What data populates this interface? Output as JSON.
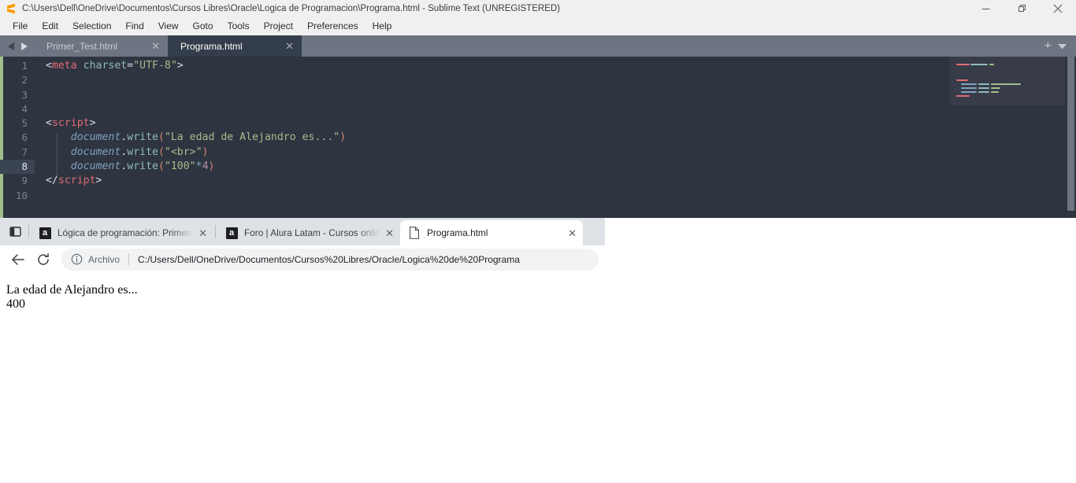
{
  "sublime": {
    "titlebar": {
      "logo_icon": "sublime-text-logo",
      "title": "C:\\Users\\Dell\\OneDrive\\Documentos\\Cursos Libres\\Oracle\\Logica de Programacion\\Programa.html - Sublime Text (UNREGISTERED)",
      "minimize_icon": "minimize-icon",
      "restore_icon": "restore-icon",
      "close_icon": "close-icon"
    },
    "menu": [
      "File",
      "Edit",
      "Selection",
      "Find",
      "View",
      "Goto",
      "Tools",
      "Project",
      "Preferences",
      "Help"
    ],
    "tabs": [
      {
        "label": "Primer_Test.html",
        "active": false,
        "close_icon": "close-icon"
      },
      {
        "label": "Programa.html",
        "active": true,
        "close_icon": "close-icon"
      }
    ],
    "tabstrip": {
      "prev_icon": "triangle-left-icon",
      "next_icon": "triangle-right-icon",
      "add_icon": "plus-icon",
      "dropdown_icon": "chevron-down-icon",
      "add_label": "+"
    },
    "editor": {
      "active_line": 8,
      "line_numbers": [
        "1",
        "2",
        "3",
        "4",
        "5",
        "6",
        "7",
        "8",
        "9",
        "10"
      ],
      "lines": [
        {
          "n": "1",
          "tokens": [
            {
              "t": "<",
              "c": "t-punct"
            },
            {
              "t": "meta",
              "c": "t-tag"
            },
            {
              "t": " ",
              "c": "t-punct"
            },
            {
              "t": "charset",
              "c": "t-attr"
            },
            {
              "t": "=",
              "c": "t-punct"
            },
            {
              "t": "\"UTF-8\"",
              "c": "t-str"
            },
            {
              "t": ">",
              "c": "t-punct"
            }
          ]
        },
        {
          "n": "2",
          "tokens": []
        },
        {
          "n": "3",
          "tokens": []
        },
        {
          "n": "4",
          "tokens": []
        },
        {
          "n": "5",
          "tokens": [
            {
              "t": "<",
              "c": "t-punct"
            },
            {
              "t": "script",
              "c": "t-tag"
            },
            {
              "t": ">",
              "c": "t-punct"
            }
          ]
        },
        {
          "n": "6",
          "tokens": [
            {
              "t": "    ",
              "c": "t-punct"
            },
            {
              "t": "document",
              "c": "t-var"
            },
            {
              "t": ".",
              "c": "t-dot"
            },
            {
              "t": "write",
              "c": "t-prop"
            },
            {
              "t": "(",
              "c": "t-paren"
            },
            {
              "t": "\"La edad de Alejandro es...\"",
              "c": "t-str"
            },
            {
              "t": ")",
              "c": "t-paren"
            }
          ]
        },
        {
          "n": "7",
          "tokens": [
            {
              "t": "    ",
              "c": "t-punct"
            },
            {
              "t": "document",
              "c": "t-var"
            },
            {
              "t": ".",
              "c": "t-dot"
            },
            {
              "t": "write",
              "c": "t-prop"
            },
            {
              "t": "(",
              "c": "t-paren"
            },
            {
              "t": "\"<br>\"",
              "c": "t-str"
            },
            {
              "t": ")",
              "c": "t-paren"
            }
          ]
        },
        {
          "n": "8",
          "tokens": [
            {
              "t": "    ",
              "c": "t-punct"
            },
            {
              "t": "document",
              "c": "t-var"
            },
            {
              "t": ".",
              "c": "t-dot"
            },
            {
              "t": "write",
              "c": "t-prop"
            },
            {
              "t": "(",
              "c": "t-paren"
            },
            {
              "t": "\"100\"",
              "c": "t-str"
            },
            {
              "t": "*",
              "c": "t-op"
            },
            {
              "t": "4",
              "c": "t-num"
            },
            {
              "t": ")",
              "c": "t-paren"
            }
          ]
        },
        {
          "n": "9",
          "tokens": [
            {
              "t": "</",
              "c": "t-punct"
            },
            {
              "t": "script",
              "c": "t-tag"
            },
            {
              "t": ">",
              "c": "t-punct"
            }
          ]
        },
        {
          "n": "10",
          "tokens": []
        }
      ]
    },
    "colors": {
      "background": "#2e3440",
      "tab_active": "#343d4b",
      "tabstrip": "#6e7582",
      "titlebar": "#f0f0f0",
      "accent_green": "#a3be8c",
      "logo_orange": "#ff9800"
    }
  },
  "browser": {
    "tab_search_icon": "tab-search-icon",
    "tabs": [
      {
        "title": "Lógica de programación: Primero",
        "favicon": "alura-favicon",
        "favicon_letter": "a",
        "active": false,
        "close_icon": "close-icon"
      },
      {
        "title": "Foro | Alura Latam - Cursos onlin",
        "favicon": "alura-favicon",
        "favicon_letter": "a",
        "active": false,
        "close_icon": "close-icon"
      },
      {
        "title": "Programa.html",
        "favicon": "file-document-icon",
        "favicon_letter": "",
        "active": true,
        "close_icon": "close-icon"
      }
    ],
    "toolbar": {
      "back_icon": "back-arrow-icon",
      "reload_icon": "reload-icon",
      "info_icon": "info-circle-icon",
      "scheme_label": "Archivo",
      "url": "C:/Users/Dell/OneDrive/Documentos/Cursos%20Libres/Oracle/Logica%20de%20Programa"
    }
  },
  "page": {
    "line1": "La edad de Alejandro es...",
    "line2": "400"
  }
}
